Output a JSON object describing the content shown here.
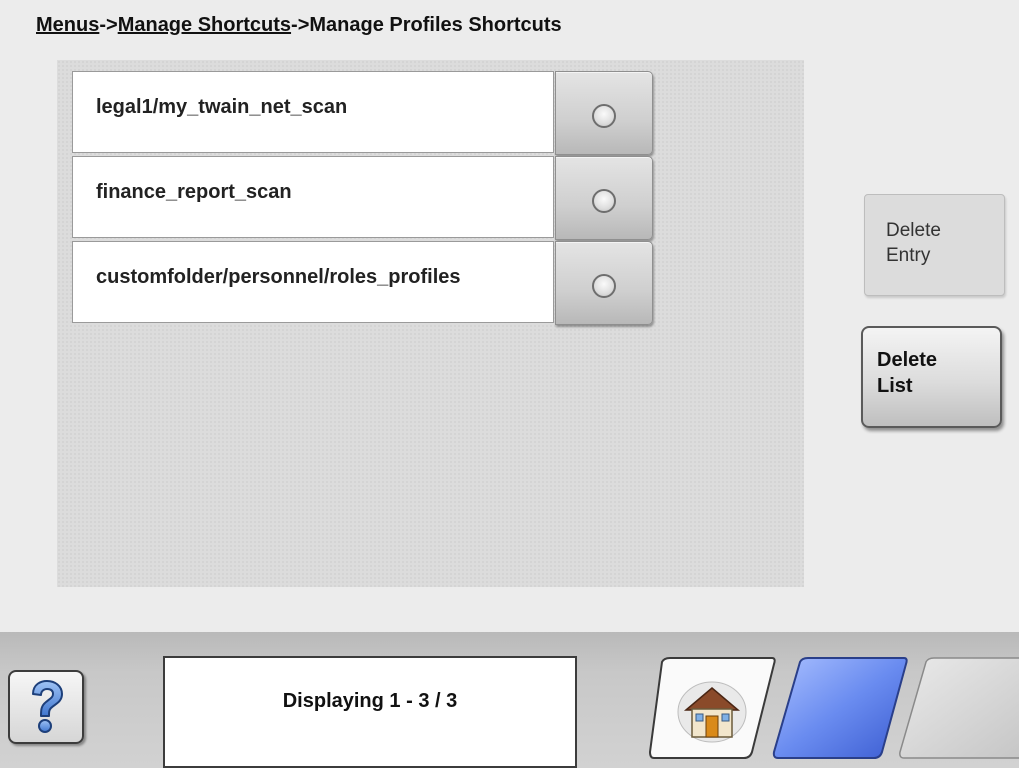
{
  "breadcrumb": {
    "item1": "Menus",
    "sep1": "->",
    "item2": "Manage Shortcuts",
    "sep2": "->",
    "current": "Manage Profiles Shortcuts"
  },
  "entries": [
    {
      "label": "legal1/my_twain_net_scan",
      "selected": false
    },
    {
      "label": "finance_report_scan",
      "selected": false
    },
    {
      "label": "customfolder/personnel/roles_profiles",
      "selected": false
    }
  ],
  "actions": {
    "delete_entry": {
      "line1": "Delete",
      "line2": "Entry",
      "enabled": false
    },
    "delete_list": {
      "line1": "Delete",
      "line2": "List",
      "enabled": true
    }
  },
  "footer": {
    "status": "Displaying 1 - 3 / 3",
    "help_icon": "question-mark-icon",
    "home_icon": "home-icon"
  },
  "colors": {
    "accent_blue": "#4a6fe0",
    "panel": "#dcdcdc"
  }
}
